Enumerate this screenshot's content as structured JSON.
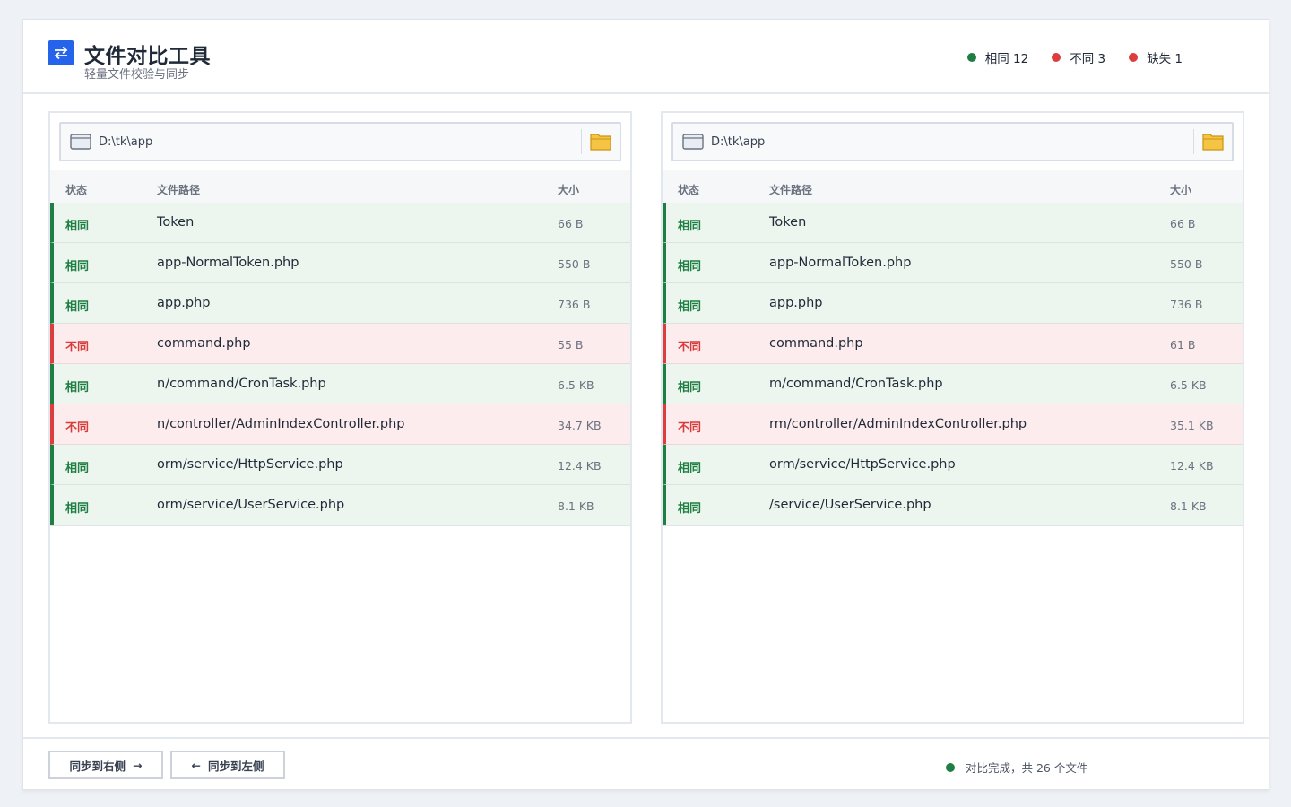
{
  "app": {
    "title": "文件对比工具",
    "subtitle": "轻量文件校验与同步"
  },
  "stats": [
    {
      "label": "相同 12",
      "color": "#1e7e43"
    },
    {
      "label": "不同 3",
      "color": "#dc3d3d"
    },
    {
      "label": "缺失 1",
      "color": "#dc3d3d"
    }
  ],
  "columns": {
    "status": "状态",
    "path": "文件路径",
    "size": "大小"
  },
  "left": {
    "path": "D:\\tk\\app",
    "rows": [
      {
        "status": "相同",
        "path": "Token",
        "size": "66 B",
        "type": "same"
      },
      {
        "status": "相同",
        "path": "app-NormalToken.php",
        "size": "550 B",
        "type": "same"
      },
      {
        "status": "相同",
        "path": "app.php",
        "size": "736 B",
        "type": "same"
      },
      {
        "status": "不同",
        "path": "command.php",
        "size": "55 B",
        "type": "diff"
      },
      {
        "status": "相同",
        "path": "n/command/CronTask.php",
        "size": "6.5 KB",
        "type": "same"
      },
      {
        "status": "不同",
        "path": "n/controller/AdminIndexController.php",
        "size": "34.7 KB",
        "type": "diff"
      },
      {
        "status": "相同",
        "path": "orm/service/HttpService.php",
        "size": "12.4 KB",
        "type": "same"
      },
      {
        "status": "相同",
        "path": "orm/service/UserService.php",
        "size": "8.1 KB",
        "type": "same"
      }
    ]
  },
  "right": {
    "path": "D:\\tk\\app",
    "rows": [
      {
        "status": "相同",
        "path": "Token",
        "size": "66 B",
        "type": "same"
      },
      {
        "status": "相同",
        "path": "app-NormalToken.php",
        "size": "550 B",
        "type": "same"
      },
      {
        "status": "相同",
        "path": "app.php",
        "size": "736 B",
        "type": "same"
      },
      {
        "status": "不同",
        "path": "command.php",
        "size": "61 B",
        "type": "diff"
      },
      {
        "status": "相同",
        "path": "m/command/CronTask.php",
        "size": "6.5 KB",
        "type": "same"
      },
      {
        "status": "不同",
        "path": "rm/controller/AdminIndexController.php",
        "size": "35.1 KB",
        "type": "diff"
      },
      {
        "status": "相同",
        "path": "orm/service/HttpService.php",
        "size": "12.4 KB",
        "type": "same"
      },
      {
        "status": "相同",
        "path": "/service/UserService.php",
        "size": "8.1 KB",
        "type": "same"
      }
    ]
  },
  "footer": {
    "sync_right": "同步到右侧",
    "sync_left": "同步到左侧",
    "status": "对比完成，共 26 个文件",
    "status_color": "#1e7e43"
  }
}
